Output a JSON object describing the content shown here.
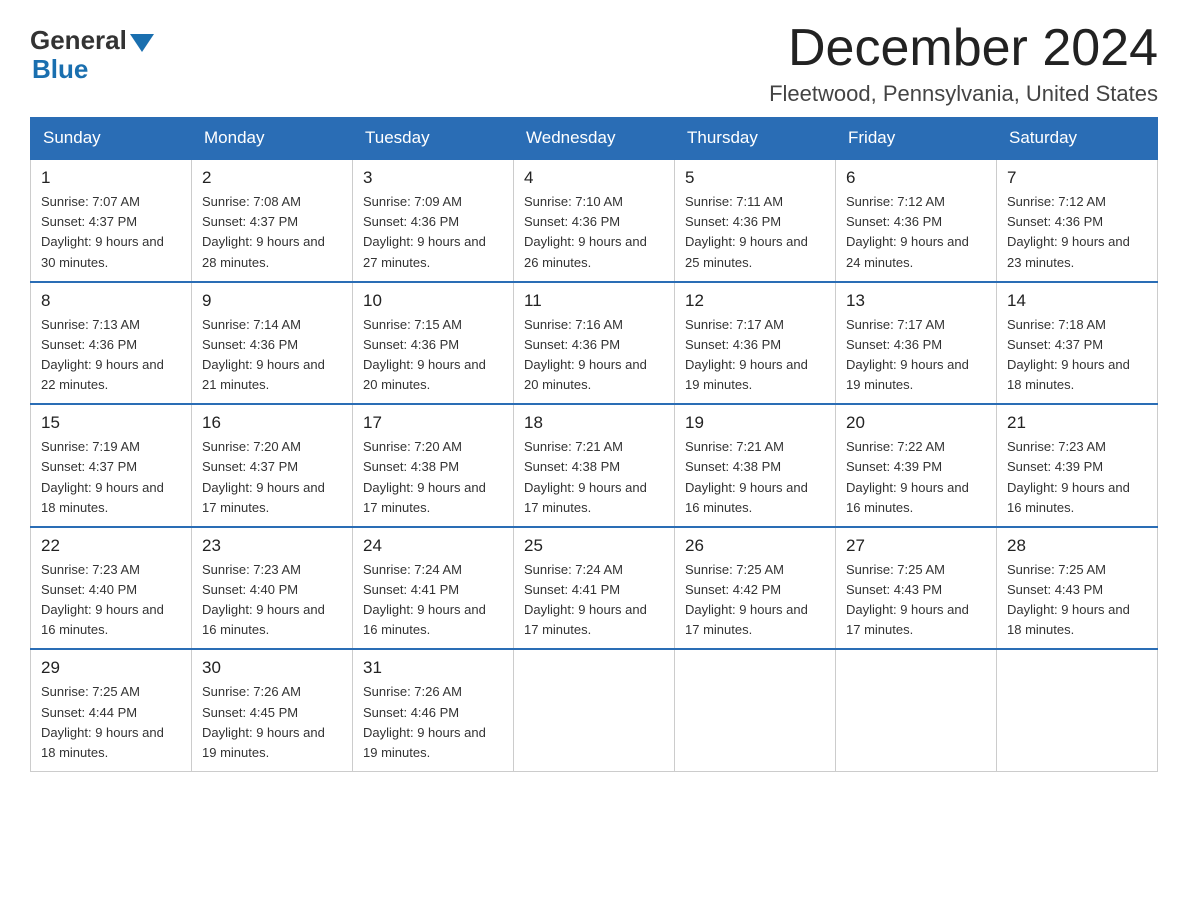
{
  "logo": {
    "general": "General",
    "blue": "Blue",
    "sub": "Blue"
  },
  "title": {
    "month": "December 2024",
    "location": "Fleetwood, Pennsylvania, United States"
  },
  "days_of_week": [
    "Sunday",
    "Monday",
    "Tuesday",
    "Wednesday",
    "Thursday",
    "Friday",
    "Saturday"
  ],
  "weeks": [
    [
      {
        "day": "1",
        "sunrise": "Sunrise: 7:07 AM",
        "sunset": "Sunset: 4:37 PM",
        "daylight": "Daylight: 9 hours and 30 minutes."
      },
      {
        "day": "2",
        "sunrise": "Sunrise: 7:08 AM",
        "sunset": "Sunset: 4:37 PM",
        "daylight": "Daylight: 9 hours and 28 minutes."
      },
      {
        "day": "3",
        "sunrise": "Sunrise: 7:09 AM",
        "sunset": "Sunset: 4:36 PM",
        "daylight": "Daylight: 9 hours and 27 minutes."
      },
      {
        "day": "4",
        "sunrise": "Sunrise: 7:10 AM",
        "sunset": "Sunset: 4:36 PM",
        "daylight": "Daylight: 9 hours and 26 minutes."
      },
      {
        "day": "5",
        "sunrise": "Sunrise: 7:11 AM",
        "sunset": "Sunset: 4:36 PM",
        "daylight": "Daylight: 9 hours and 25 minutes."
      },
      {
        "day": "6",
        "sunrise": "Sunrise: 7:12 AM",
        "sunset": "Sunset: 4:36 PM",
        "daylight": "Daylight: 9 hours and 24 minutes."
      },
      {
        "day": "7",
        "sunrise": "Sunrise: 7:12 AM",
        "sunset": "Sunset: 4:36 PM",
        "daylight": "Daylight: 9 hours and 23 minutes."
      }
    ],
    [
      {
        "day": "8",
        "sunrise": "Sunrise: 7:13 AM",
        "sunset": "Sunset: 4:36 PM",
        "daylight": "Daylight: 9 hours and 22 minutes."
      },
      {
        "day": "9",
        "sunrise": "Sunrise: 7:14 AM",
        "sunset": "Sunset: 4:36 PM",
        "daylight": "Daylight: 9 hours and 21 minutes."
      },
      {
        "day": "10",
        "sunrise": "Sunrise: 7:15 AM",
        "sunset": "Sunset: 4:36 PM",
        "daylight": "Daylight: 9 hours and 20 minutes."
      },
      {
        "day": "11",
        "sunrise": "Sunrise: 7:16 AM",
        "sunset": "Sunset: 4:36 PM",
        "daylight": "Daylight: 9 hours and 20 minutes."
      },
      {
        "day": "12",
        "sunrise": "Sunrise: 7:17 AM",
        "sunset": "Sunset: 4:36 PM",
        "daylight": "Daylight: 9 hours and 19 minutes."
      },
      {
        "day": "13",
        "sunrise": "Sunrise: 7:17 AM",
        "sunset": "Sunset: 4:36 PM",
        "daylight": "Daylight: 9 hours and 19 minutes."
      },
      {
        "day": "14",
        "sunrise": "Sunrise: 7:18 AM",
        "sunset": "Sunset: 4:37 PM",
        "daylight": "Daylight: 9 hours and 18 minutes."
      }
    ],
    [
      {
        "day": "15",
        "sunrise": "Sunrise: 7:19 AM",
        "sunset": "Sunset: 4:37 PM",
        "daylight": "Daylight: 9 hours and 18 minutes."
      },
      {
        "day": "16",
        "sunrise": "Sunrise: 7:20 AM",
        "sunset": "Sunset: 4:37 PM",
        "daylight": "Daylight: 9 hours and 17 minutes."
      },
      {
        "day": "17",
        "sunrise": "Sunrise: 7:20 AM",
        "sunset": "Sunset: 4:38 PM",
        "daylight": "Daylight: 9 hours and 17 minutes."
      },
      {
        "day": "18",
        "sunrise": "Sunrise: 7:21 AM",
        "sunset": "Sunset: 4:38 PM",
        "daylight": "Daylight: 9 hours and 17 minutes."
      },
      {
        "day": "19",
        "sunrise": "Sunrise: 7:21 AM",
        "sunset": "Sunset: 4:38 PM",
        "daylight": "Daylight: 9 hours and 16 minutes."
      },
      {
        "day": "20",
        "sunrise": "Sunrise: 7:22 AM",
        "sunset": "Sunset: 4:39 PM",
        "daylight": "Daylight: 9 hours and 16 minutes."
      },
      {
        "day": "21",
        "sunrise": "Sunrise: 7:23 AM",
        "sunset": "Sunset: 4:39 PM",
        "daylight": "Daylight: 9 hours and 16 minutes."
      }
    ],
    [
      {
        "day": "22",
        "sunrise": "Sunrise: 7:23 AM",
        "sunset": "Sunset: 4:40 PM",
        "daylight": "Daylight: 9 hours and 16 minutes."
      },
      {
        "day": "23",
        "sunrise": "Sunrise: 7:23 AM",
        "sunset": "Sunset: 4:40 PM",
        "daylight": "Daylight: 9 hours and 16 minutes."
      },
      {
        "day": "24",
        "sunrise": "Sunrise: 7:24 AM",
        "sunset": "Sunset: 4:41 PM",
        "daylight": "Daylight: 9 hours and 16 minutes."
      },
      {
        "day": "25",
        "sunrise": "Sunrise: 7:24 AM",
        "sunset": "Sunset: 4:41 PM",
        "daylight": "Daylight: 9 hours and 17 minutes."
      },
      {
        "day": "26",
        "sunrise": "Sunrise: 7:25 AM",
        "sunset": "Sunset: 4:42 PM",
        "daylight": "Daylight: 9 hours and 17 minutes."
      },
      {
        "day": "27",
        "sunrise": "Sunrise: 7:25 AM",
        "sunset": "Sunset: 4:43 PM",
        "daylight": "Daylight: 9 hours and 17 minutes."
      },
      {
        "day": "28",
        "sunrise": "Sunrise: 7:25 AM",
        "sunset": "Sunset: 4:43 PM",
        "daylight": "Daylight: 9 hours and 18 minutes."
      }
    ],
    [
      {
        "day": "29",
        "sunrise": "Sunrise: 7:25 AM",
        "sunset": "Sunset: 4:44 PM",
        "daylight": "Daylight: 9 hours and 18 minutes."
      },
      {
        "day": "30",
        "sunrise": "Sunrise: 7:26 AM",
        "sunset": "Sunset: 4:45 PM",
        "daylight": "Daylight: 9 hours and 19 minutes."
      },
      {
        "day": "31",
        "sunrise": "Sunrise: 7:26 AM",
        "sunset": "Sunset: 4:46 PM",
        "daylight": "Daylight: 9 hours and 19 minutes."
      },
      null,
      null,
      null,
      null
    ]
  ]
}
